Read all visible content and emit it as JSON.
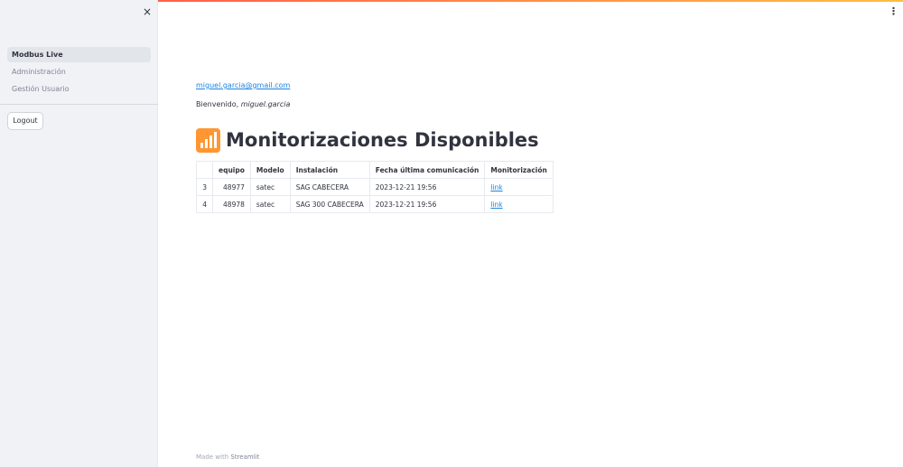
{
  "accent": {
    "top_bar_from": "#ff4b4b",
    "top_bar_to": "#ffbd45",
    "link": "#1c83e1",
    "title_icon": "#ff9632"
  },
  "sidebar": {
    "close_label": "×",
    "items": [
      {
        "label": "Modbus Live",
        "active": true
      },
      {
        "label": "Administración",
        "active": false
      },
      {
        "label": "Gestión Usuario",
        "active": false
      }
    ],
    "logout_label": "Logout"
  },
  "header": {
    "menu_label": "⋮"
  },
  "main": {
    "email": "miguel.garcia@gmail.com",
    "welcome_prefix": "Bienvenido, ",
    "welcome_user": "miguel.garcia",
    "title": "Monitorizaciones Disponibles",
    "title_icon": "bar-chart-icon",
    "table": {
      "columns": [
        "",
        "equipo",
        "Modelo",
        "Instalación",
        "Fecha última comunicación",
        "Monitorización"
      ],
      "rows": [
        {
          "index": "3",
          "equipo": "48977",
          "modelo": "satec",
          "instalacion": "SAG CABECERA",
          "fecha": "2023-12-21 19:56",
          "link": "link"
        },
        {
          "index": "4",
          "equipo": "48978",
          "modelo": "satec",
          "instalacion": "SAG 300 CABECERA",
          "fecha": "2023-12-21 19:56",
          "link": "link"
        }
      ]
    },
    "footer_prefix": "Made with ",
    "footer_brand": "Streamlit"
  }
}
